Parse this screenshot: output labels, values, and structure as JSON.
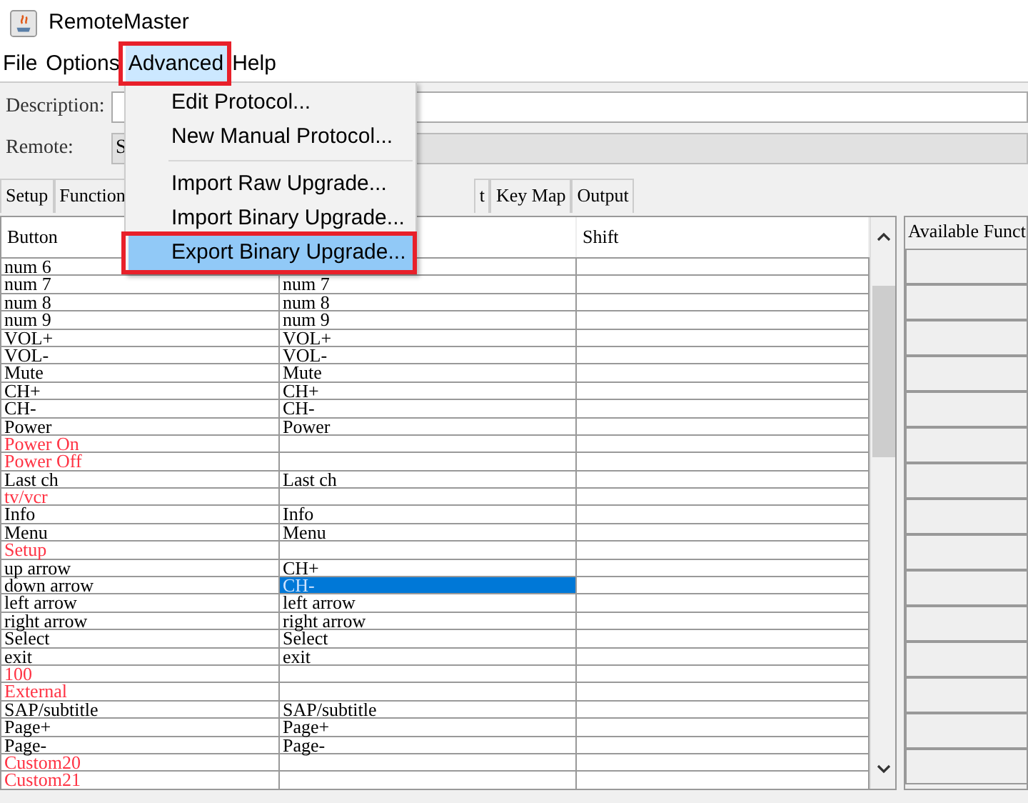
{
  "window": {
    "title": "RemoteMaster"
  },
  "menu_bar": [
    {
      "label": "File",
      "selected": false,
      "highlighted": false
    },
    {
      "label": "Options",
      "selected": false,
      "highlighted": false
    },
    {
      "label": "Advanced",
      "selected": true,
      "highlighted": true
    },
    {
      "label": "Help",
      "selected": false,
      "highlighted": false
    }
  ],
  "open_menu": {
    "items": [
      {
        "kind": "item",
        "label": "Edit Protocol...",
        "selected": false,
        "highlighted": false
      },
      {
        "kind": "item",
        "label": "New Manual Protocol...",
        "selected": false,
        "highlighted": false
      },
      {
        "kind": "separator"
      },
      {
        "kind": "item",
        "label": "Import Raw Upgrade...",
        "selected": false,
        "highlighted": false
      },
      {
        "kind": "item",
        "label": "Import Binary Upgrade...",
        "selected": false,
        "highlighted": false
      },
      {
        "kind": "item",
        "label": "Export Binary Upgrade...",
        "selected": true,
        "highlighted": true
      }
    ]
  },
  "form": {
    "description_label": "Description:",
    "remote_label": "Remote:",
    "remote_value": "S"
  },
  "tabs": [
    {
      "label": "Setup",
      "selected": false
    },
    {
      "label": "Function",
      "selected": false
    },
    {
      "label": "t",
      "selected": false
    },
    {
      "label": "Key Map",
      "selected": false
    },
    {
      "label": "Output",
      "selected": false
    }
  ],
  "table": {
    "columns": [
      "Button",
      "",
      "Shift"
    ],
    "rows": [
      {
        "button": "num 6",
        "function": "",
        "assigned": true,
        "selected": false
      },
      {
        "button": "num 7",
        "function": "num 7",
        "assigned": true,
        "selected": false
      },
      {
        "button": "num 8",
        "function": "num 8",
        "assigned": true,
        "selected": false
      },
      {
        "button": "num 9",
        "function": "num 9",
        "assigned": true,
        "selected": false
      },
      {
        "button": "VOL+",
        "function": "VOL+",
        "assigned": true,
        "selected": false
      },
      {
        "button": "VOL-",
        "function": "VOL-",
        "assigned": true,
        "selected": false
      },
      {
        "button": "Mute",
        "function": "Mute",
        "assigned": true,
        "selected": false
      },
      {
        "button": "CH+",
        "function": "CH+",
        "assigned": true,
        "selected": false
      },
      {
        "button": "CH-",
        "function": "CH-",
        "assigned": true,
        "selected": false
      },
      {
        "button": "Power",
        "function": "Power",
        "assigned": true,
        "selected": false
      },
      {
        "button": "Power On",
        "function": "",
        "assigned": false,
        "selected": false
      },
      {
        "button": "Power Off",
        "function": "",
        "assigned": false,
        "selected": false
      },
      {
        "button": "Last ch",
        "function": "Last ch",
        "assigned": true,
        "selected": false
      },
      {
        "button": "tv/vcr",
        "function": "",
        "assigned": false,
        "selected": false
      },
      {
        "button": "Info",
        "function": "Info",
        "assigned": true,
        "selected": false
      },
      {
        "button": "Menu",
        "function": "Menu",
        "assigned": true,
        "selected": false
      },
      {
        "button": "Setup",
        "function": "",
        "assigned": false,
        "selected": false
      },
      {
        "button": "up arrow",
        "function": "CH+",
        "assigned": true,
        "selected": false
      },
      {
        "button": "down arrow",
        "function": "CH-",
        "assigned": true,
        "selected": true
      },
      {
        "button": "left arrow",
        "function": "left arrow",
        "assigned": true,
        "selected": false
      },
      {
        "button": "right arrow",
        "function": "right arrow",
        "assigned": true,
        "selected": false
      },
      {
        "button": "Select",
        "function": "Select",
        "assigned": true,
        "selected": false
      },
      {
        "button": "exit",
        "function": "exit",
        "assigned": true,
        "selected": false
      },
      {
        "button": "100",
        "function": "",
        "assigned": false,
        "selected": false
      },
      {
        "button": "External",
        "function": "",
        "assigned": false,
        "selected": false
      },
      {
        "button": "SAP/subtitle",
        "function": "SAP/subtitle",
        "assigned": true,
        "selected": false
      },
      {
        "button": "Page+",
        "function": "Page+",
        "assigned": true,
        "selected": false
      },
      {
        "button": "Page-",
        "function": "Page-",
        "assigned": true,
        "selected": false
      },
      {
        "button": "Custom20",
        "function": "",
        "assigned": false,
        "selected": false
      },
      {
        "button": "Custom21",
        "function": "",
        "assigned": false,
        "selected": false
      }
    ]
  },
  "side_panel": {
    "title": "Available Funct"
  }
}
